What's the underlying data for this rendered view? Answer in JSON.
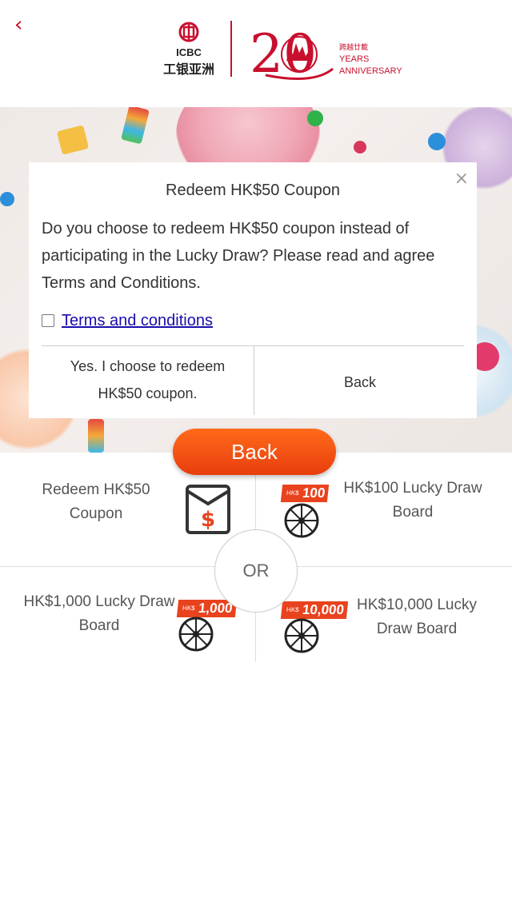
{
  "header": {
    "back_icon": "chevron-left-icon",
    "brand_short": "ICBC",
    "brand_chinese": "工银亚洲",
    "anniversary_number": "20",
    "anniversary_chinese": "跨越廿載",
    "anniversary_line1": "YEARS",
    "anniversary_line2": "ANNIVERSARY",
    "brand_color": "#c8102e"
  },
  "modal": {
    "title": "Redeem HK$50 Coupon",
    "body": "Do you choose to redeem HK$50 coupon instead of participating in the Lucky Draw? Please read and agree Terms and Conditions.",
    "terms_label": "Terms and conditions",
    "terms_checked": false,
    "confirm_line1": "Yes. I choose to redeem",
    "confirm_line2": "HK$50 coupon.",
    "back_label": "Back",
    "close_icon": "close-icon"
  },
  "main": {
    "back_button": "Back",
    "or_label": "OR",
    "options": [
      {
        "label_line1": "Redeem HK$50",
        "label_line2": "Coupon",
        "icon": "coupon-envelope-icon"
      },
      {
        "label_line1": "HK$100 Lucky Draw",
        "label_line2": "Board",
        "tag_prefix": "HK$",
        "tag_value": "100",
        "icon": "wheel-icon"
      },
      {
        "label_line1": "HK$1,000 Lucky Draw",
        "label_line2": "Board",
        "tag_prefix": "HK$",
        "tag_value": "1,000",
        "icon": "wheel-icon"
      },
      {
        "label_line1": "HK$10,000 Lucky",
        "label_line2": "Draw Board",
        "tag_prefix": "HK$",
        "tag_value": "10,000",
        "icon": "wheel-icon"
      }
    ],
    "accent_color": "#e8431e"
  }
}
